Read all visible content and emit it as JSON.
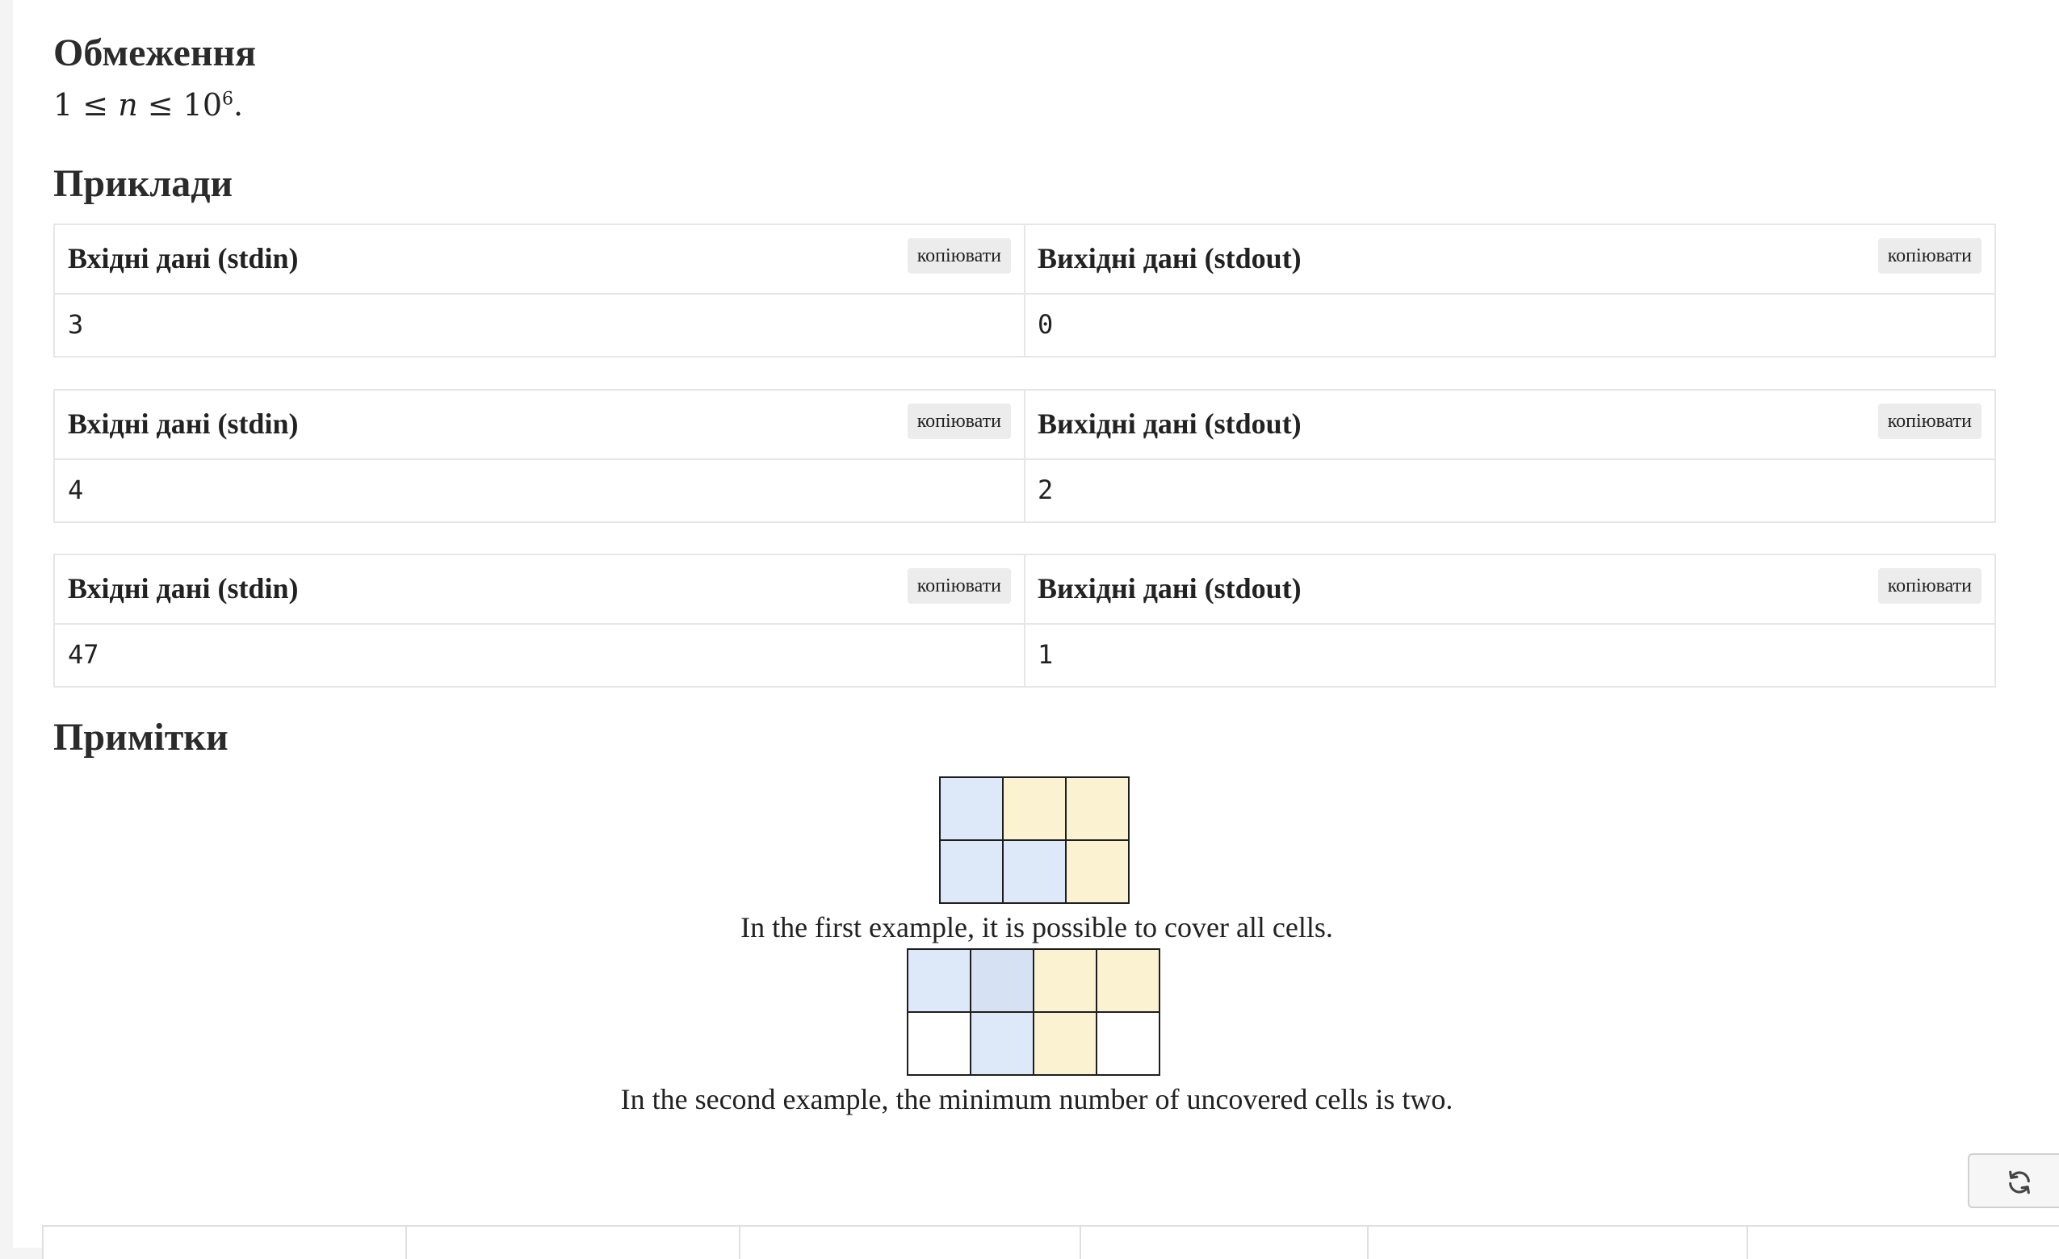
{
  "sections": {
    "constraints_title": "Обмеження",
    "examples_title": "Приклади",
    "notes_title": "Примітки"
  },
  "constraint": {
    "lhs": "1 ≤ ",
    "var": "n",
    "rhs": " ≤ 10",
    "exp": "6",
    "end": "."
  },
  "examples": [
    {
      "input_label": "Вхідні дані (stdin)",
      "output_label": "Вихідні дані (stdout)",
      "copy_label": "копіювати",
      "input": "3",
      "output": "0"
    },
    {
      "input_label": "Вхідні дані (stdin)",
      "output_label": "Вихідні дані (stdout)",
      "copy_label": "копіювати",
      "input": "4",
      "output": "2"
    },
    {
      "input_label": "Вхідні дані (stdin)",
      "output_label": "Вихідні дані (stdout)",
      "copy_label": "копіювати",
      "input": "47",
      "output": "1"
    }
  ],
  "notes": {
    "caption1": "In the first example, it is possible to cover all cells.",
    "caption2": "In the second example, the minimum number of uncovered cells is two.",
    "grid1": [
      [
        "#dde8f8",
        "#fbf2d2",
        "#fbf2d2"
      ],
      [
        "#dde8f8",
        "#dde8f8",
        "#fbf2d2"
      ]
    ],
    "grid2": [
      [
        "#dde8f8",
        "#d6e1f3",
        "#fbf2d2",
        "#fbf2d2"
      ],
      [
        "#ffffff",
        "#dde8f8",
        "#fbf2d2",
        "#ffffff"
      ]
    ]
  },
  "icons": {
    "refresh": "refresh-icon"
  },
  "table_header": [
    "",
    "",
    "",
    "",
    "",
    ""
  ]
}
